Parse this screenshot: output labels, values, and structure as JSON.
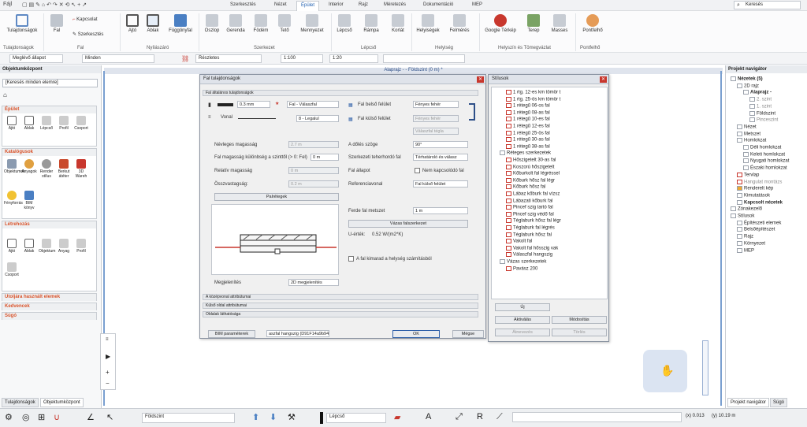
{
  "topbar": {
    "file_menu": "Fájl",
    "tabs": [
      "Szerkesztés",
      "Nézet",
      "Épület",
      "Interior",
      "Rajz",
      "Méretezés",
      "Dokumentáció",
      "MEP"
    ],
    "search_placeholder": "Keresés"
  },
  "ribbon": {
    "items": {
      "wall_props": "Tulajdonságok",
      "wall": "Fal",
      "kapcsolat": "Kapcsolat",
      "szerkesztes": "Szerkesztés",
      "door": "Ajtó",
      "window": "Ablak",
      "curtain": "Függönyfal",
      "column": "Oszlop",
      "beam": "Gerenda",
      "slab": "Födém",
      "roof": "Tető",
      "mennyezet": "Mennyezet",
      "stair": "Lépcső",
      "ramp": "Rámpa",
      "railing": "Korlát",
      "rooms": "Helyiségek",
      "survey": "Felmérés",
      "gmap": "Google Térkép",
      "terrain": "Terep",
      "masses": "Masses",
      "pontfelho": "Pontfelhő"
    },
    "groups": {
      "g1": "Tulajdonságok",
      "g2": "Fal",
      "g3": "Nyílászáró",
      "g4": "Szerkezet",
      "g5": "Lépcső",
      "g6": "Helyiség",
      "g7": "Helyszín és Tömegvázlat",
      "g8": "Pontfelhő"
    }
  },
  "toolbar2": {
    "state": "Meglévő állapot",
    "all": "Minden",
    "detail": "Részletes",
    "scale": "1:100",
    "lineweight": "1:20"
  },
  "left": {
    "title": "Objektumközpont",
    "search": "[Keresés minden elemre]",
    "cats": [
      "Épület",
      "Katalógusok",
      "Létrehozás",
      "Utoljára használt elemek",
      "Kedvencek",
      "Súgó"
    ],
    "epulet_tools": [
      "Ajtó",
      "Ablak",
      "Lépcső",
      "Profil",
      "Csoport"
    ],
    "katalogus_tools": [
      "Objektumok",
      "Anyagok",
      "Render stílus",
      "Berkut átéter",
      "3D Wareh",
      "Fényforrás",
      "BIM könyv"
    ],
    "letrehozas_tools": [
      "Ajtó",
      "Ablak",
      "Objektum",
      "Anyag",
      "Profil",
      "Csoport"
    ],
    "tabs": [
      "Tulajdonságok",
      "Objektumközpont"
    ]
  },
  "canvas": {
    "view_title": "Alaprajz - - Földszint (0 m) *"
  },
  "falprops": {
    "title": "Fal tulajdonságok",
    "section_general": "Fal általános tulajdonságok",
    "thickness": "0.3 mm",
    "wall_type": "Fal - Válaszfal",
    "line_type": "Vonal",
    "layer": "8 - Legalul",
    "labels": {
      "height": "Névleges magasság",
      "height_diff": "Fal magasság különbség a szinttől (> 0: Fel)",
      "rel_height": "Relatív magasság",
      "total_height": "Összvastagság:",
      "inner_surface": "Fal belső felület",
      "outer_surface": "Fal külső felület",
      "tilt": "A dőlés szöge",
      "structural": "Szerkezeti teherhordó fal",
      "state": "Fal állapot",
      "ref_line": "Referenciavonal",
      "slope_thick": "Ferde fal metszet",
      "uval": "U-érték:",
      "uval_val": "0.52 W/(m2*K)",
      "visibility": "Megjelenítés",
      "room_calc": "A fal kimarad a helység számításból"
    },
    "values": {
      "height": "2.7 m",
      "height_diff": "0 m",
      "rel_height": "0 m",
      "total_height": "0.2 m",
      "inner_mat": "Fényes fehér",
      "outer_mat": "Fényes fehér",
      "outer_mat2": "Válaszfal tégla",
      "tilt": "90°",
      "structural": "Térhatároló és válasz",
      "nonconn": "Nem kapcsolódó fal",
      "ref_line": "Fal külső felület",
      "slope": "1 m",
      "visibility": "2D megjelenítés"
    },
    "buttons": {
      "layers": "Palrétegek",
      "compose": "Vázas falszerkezet",
      "bim": "BIM paraméterek",
      "guid": "aszfal hangszig (D91F14a9b94",
      "ok": "OK",
      "cancel": "Mégse"
    },
    "sections": [
      "A középvonal attribútumai",
      "Külső oldal attribútumai",
      "Oldalak láthatósága"
    ]
  },
  "styles": {
    "title": "Stílusok",
    "items": [
      "1 rtg. 12-es km tömör t",
      "1 rtg. 25-ös km tömör t",
      "1 rétegű 06-os fal",
      "1 rétegű 08-as fal",
      "1 rétegű 10-es fal",
      "1 rétegű 12-es fal",
      "1 rétegű 25-ös fal",
      "1 rétegű 30-as fal",
      "1 rétegű 38-as fal",
      "Réteges szerkezetek",
      "Hőszigetelt 30-as fal",
      "Koszorú hőszigetelt",
      "Kőburkolt fal légréssel",
      "Kőburk hősz fal légr",
      "Kőburk hősz fal",
      "Lábaz kőburk fal vízsz",
      "Lábazati kőburk fal",
      "Pincef szig tartó fal",
      "Pincef szig védő fal",
      "Téglaburk hősz fal légr",
      "Téglaburk fal légrés",
      "Téglaburk hősz fal",
      "Vakolt fal",
      "Vakolt fal hősszig vak",
      "Válaszfal hangszig",
      "Vázas szerkezetek",
      "Pavász 200"
    ],
    "buttons": {
      "new": "Új",
      "activate": "Aktiválás",
      "modify": "Módosítás",
      "rename": "Átnevezés",
      "delete": "Törlés"
    }
  },
  "right": {
    "title": "Projekt navigátor",
    "tree": [
      "Nézetek (5)",
      "2D rajz",
      "Alaprajz -",
      "2. szint",
      "1. szint",
      "Földszint",
      "Pinceszint",
      "Nézet",
      "Metszet",
      "Homlokzat",
      "Déli homlokzat",
      "Keleti homlokzat",
      "Nyugati homlokzat",
      "Északi homlokzat",
      "Tervlap",
      "Hangulat montázs",
      "Renderelt kép",
      "Kimutatások",
      "Kapcsolt nézetek",
      "Zónakezelő",
      "Stílusok",
      "Építészeti elemek",
      "Belsőépítészet",
      "Rajz",
      "Környezet",
      "MEP"
    ],
    "tabs": [
      "Projekt navigátor",
      "Súgó"
    ]
  },
  "bottom": {
    "floor": "Földszint",
    "stair": "Lépcső",
    "coord_x": "(x) 0.013",
    "coord_y": "(y) 10.19 m"
  },
  "colors": {
    "accent": "#1f5fb0",
    "orange": "#d9532a",
    "red": "#c8372d"
  }
}
